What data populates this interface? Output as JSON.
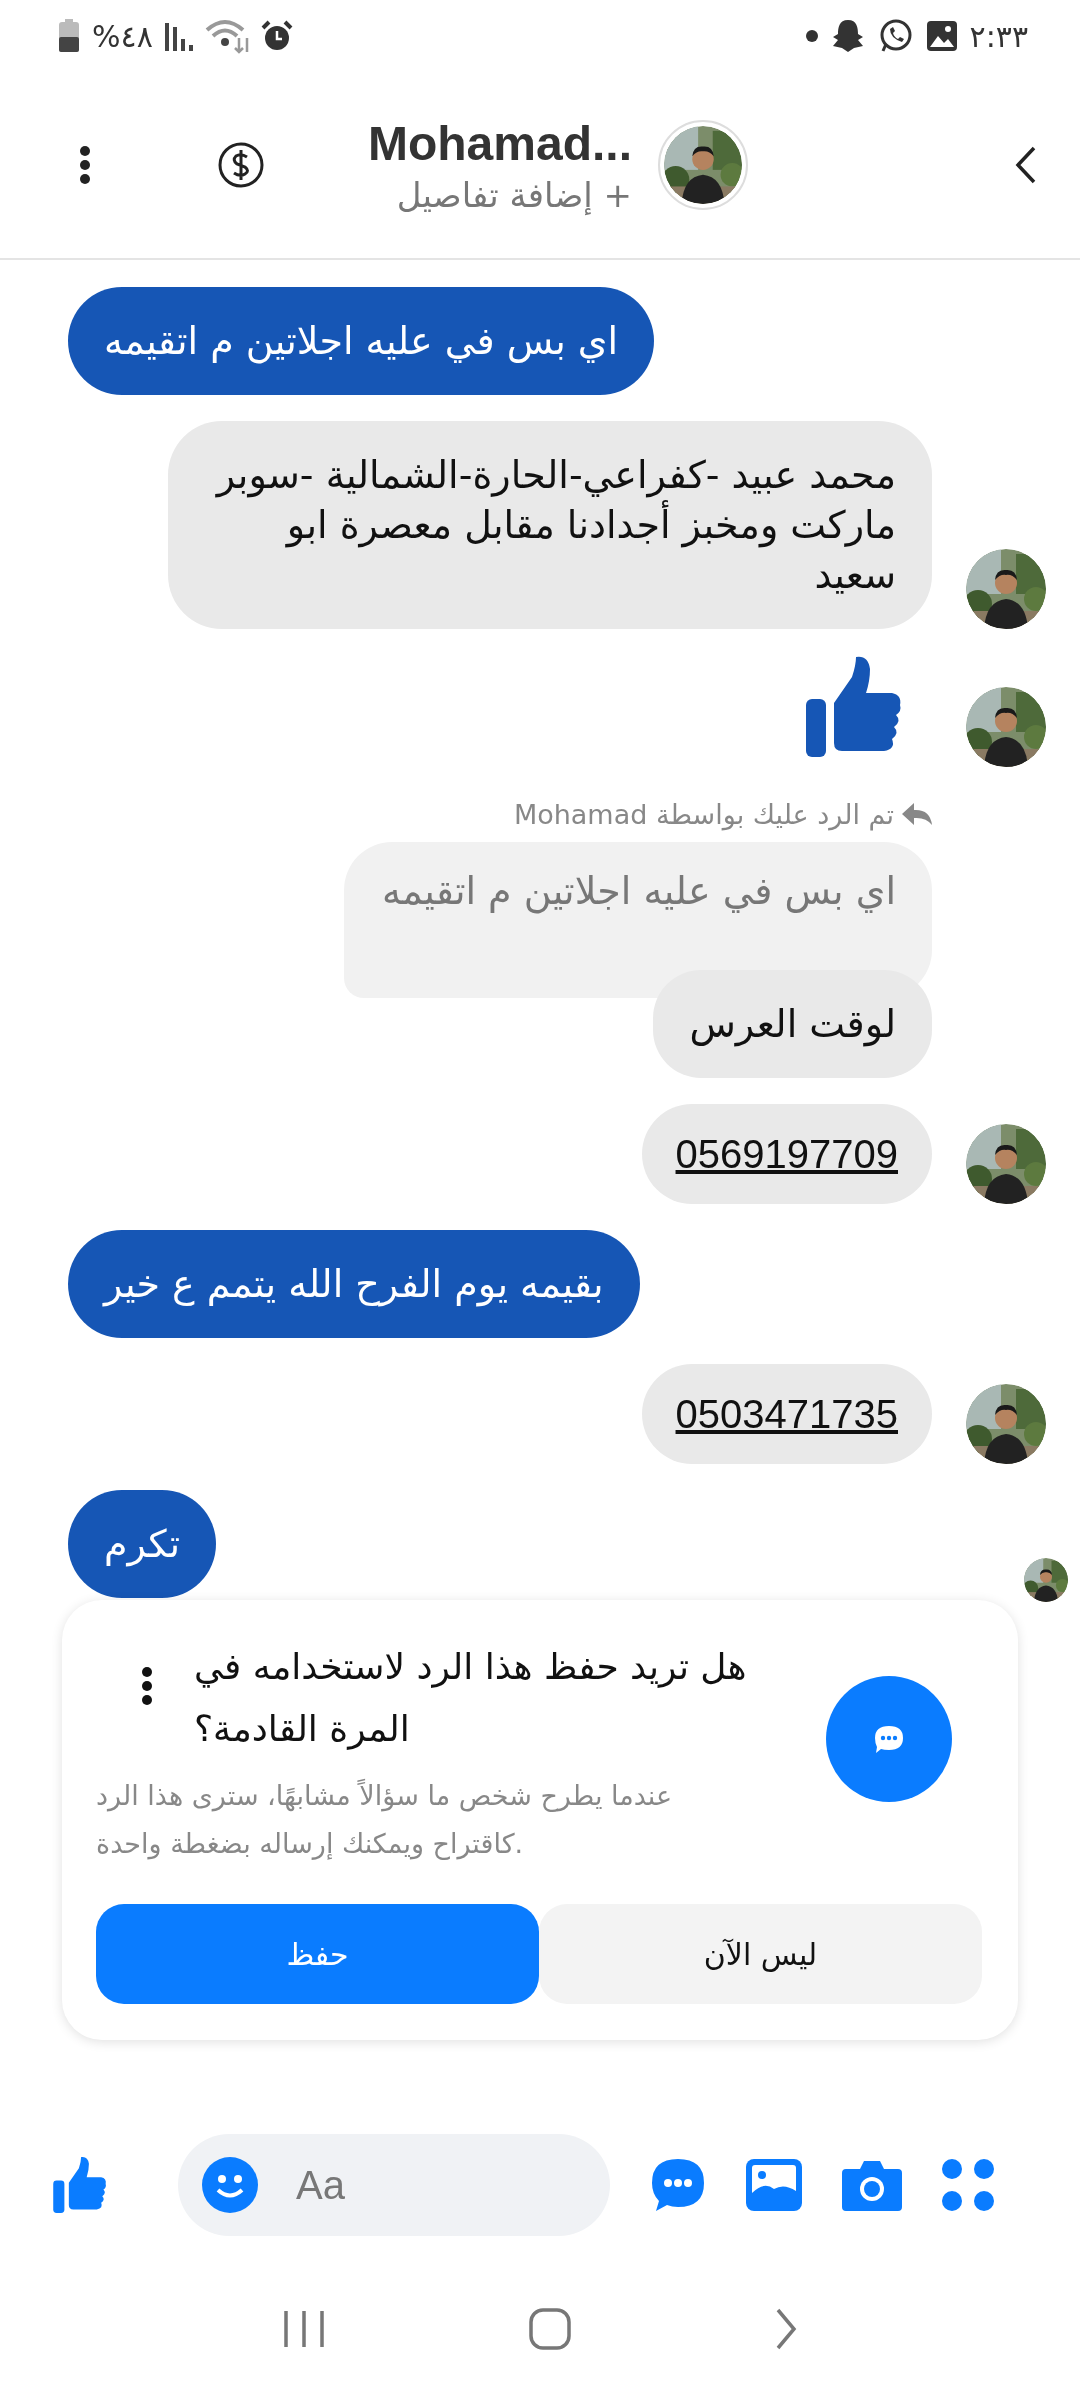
{
  "status_bar": {
    "battery": "%٤٨",
    "time": "٢:٣٣"
  },
  "header": {
    "name": "Mohamad...",
    "subtitle": "+ إضافة تفاصيل"
  },
  "messages": [
    {
      "kind": "sent",
      "text": "اي بس في عليه اجلاتين م اتقيمه",
      "seen": false
    },
    {
      "kind": "received",
      "text": "محمد عبيد -كفراعي-الحارة-الشمالية -سوبر ماركت ومخبز أجدادنا مقابل معصرة ابو سعيد",
      "avatar": true
    },
    {
      "kind": "like",
      "avatar": true
    },
    {
      "kind": "reply",
      "label": "تم الرد عليك بواسطة Mohamad",
      "quote": "اي بس في عليه اجلاتين م اتقيمه",
      "text": "لوقت العرس"
    },
    {
      "kind": "phone",
      "text": "0569197709",
      "avatar": true
    },
    {
      "kind": "sent",
      "text": "بقيمه يوم الفرح الله يتمم ع خير",
      "seen": false
    },
    {
      "kind": "phone",
      "text": "0503471735",
      "avatar": true
    },
    {
      "kind": "sent",
      "text": "تكرم",
      "seen": true
    }
  ],
  "save_prompt": {
    "title": "هل تريد حفظ هذا الرد لاستخدامه في المرة القادمة؟",
    "description": "عندما يطرح شخص ما سؤالاً مشابهًا، سترى هذا الرد كاقتراح ويمكنك إرساله بضغطة واحدة.",
    "buttons": [
      {
        "label": "ليس الآن",
        "primary": false
      },
      {
        "label": "حفظ",
        "primary": true
      }
    ]
  },
  "composer": {
    "placeholder": "Aa"
  }
}
